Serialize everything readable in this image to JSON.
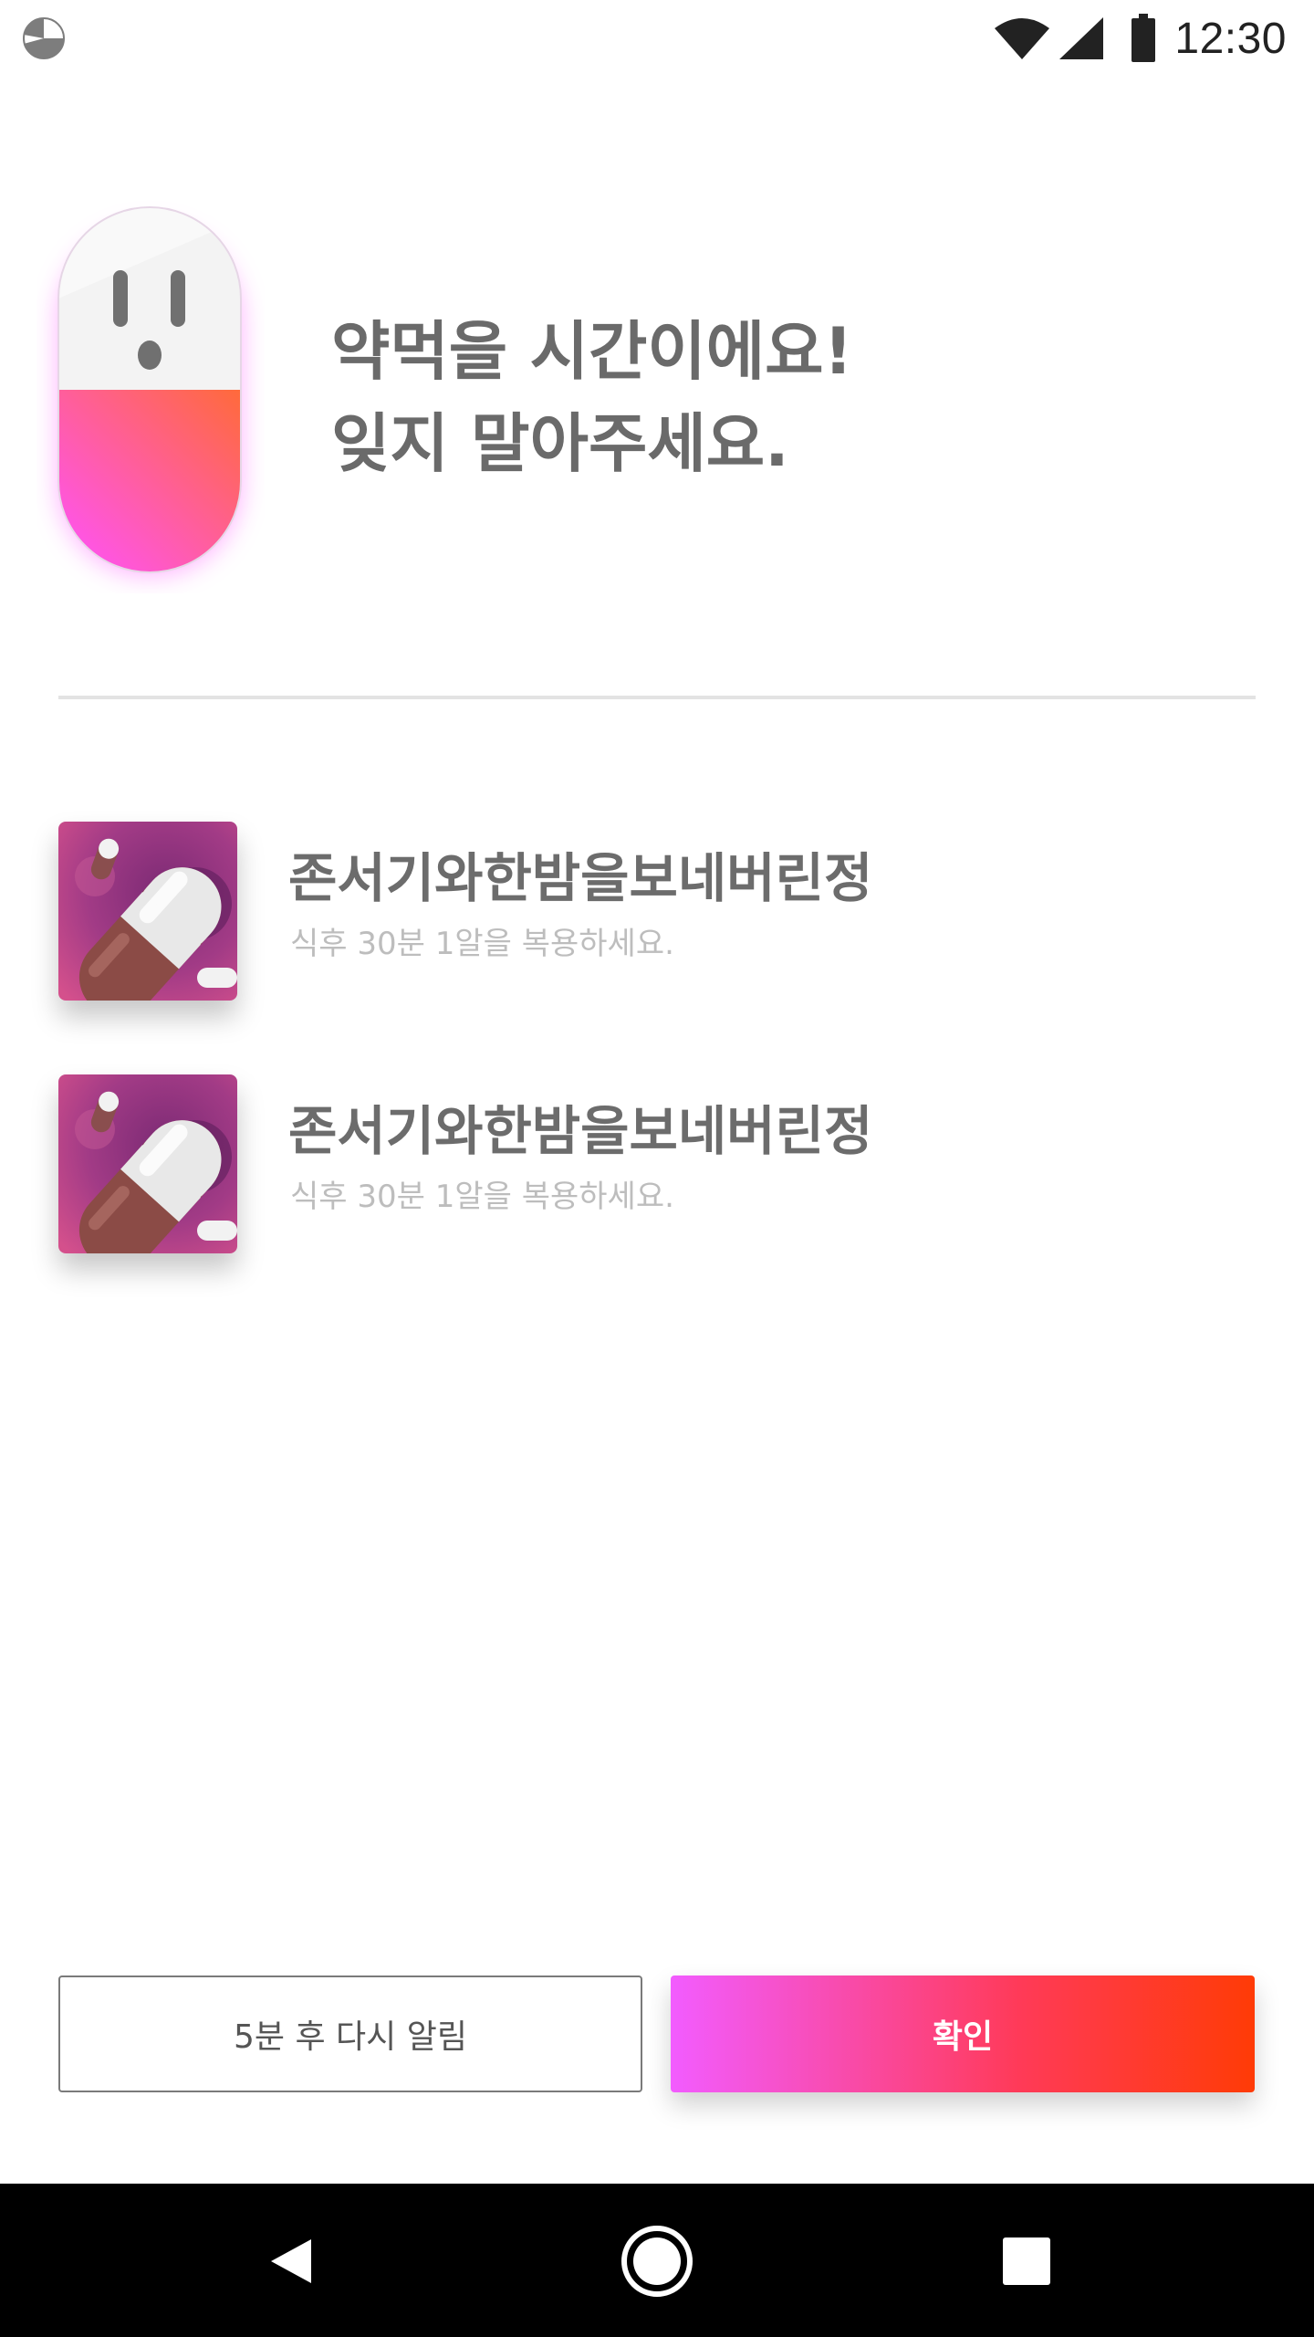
{
  "status_bar": {
    "time": "12:30",
    "icons": [
      "app-notification-icon",
      "wifi-icon",
      "cell-signal-icon",
      "battery-icon"
    ]
  },
  "header": {
    "line1": "약먹을 시간이에요!",
    "line2": "잊지 말아주세요.",
    "mascot": "pill-mascot-icon"
  },
  "medications": [
    {
      "name": "존서기와한밤을보네버린정",
      "instruction": "식후 30분 1알을 복용하세요.",
      "image": "capsule-photo"
    },
    {
      "name": "존서기와한밤을보네버린정",
      "instruction": "식후 30분 1알을 복용하세요.",
      "image": "capsule-photo"
    }
  ],
  "actions": {
    "snooze_label": "5분 후 다시 알림",
    "confirm_label": "확인"
  },
  "nav": {
    "icons": [
      "back-icon",
      "home-icon",
      "recents-icon"
    ]
  },
  "colors": {
    "accent_start": "#f25cff",
    "accent_end": "#ff3b06",
    "headline_text": "#6a6a6a",
    "sub_text": "#bdbdbd",
    "divider": "#e3e3e3"
  }
}
